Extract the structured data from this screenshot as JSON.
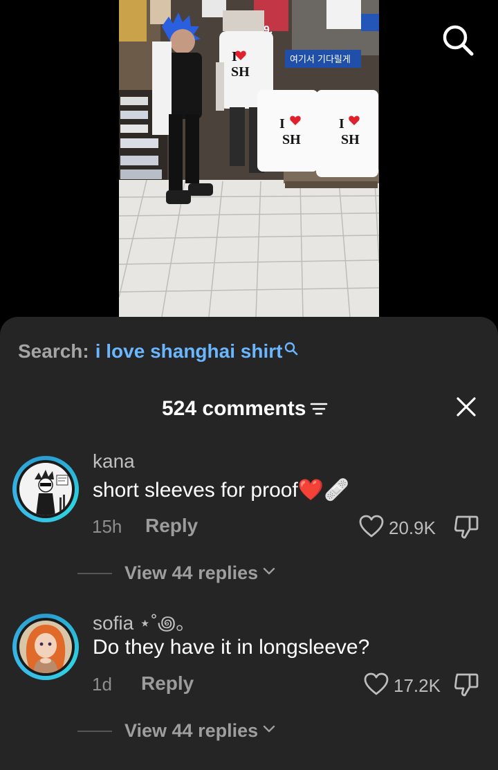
{
  "search": {
    "prefix": "Search:",
    "query": "i love shanghai shirt"
  },
  "video": {
    "shirt_text": [
      "I",
      "SH"
    ],
    "store_sign": "여기서 기다릴게",
    "price_tag": "39."
  },
  "header": {
    "count_label": "524 comments"
  },
  "comments": [
    {
      "username": "kana",
      "text": "short sleeves for proof❤️🩹",
      "time": "15h",
      "reply_label": "Reply",
      "likes": "20.9K",
      "view_replies": "View 44 replies"
    },
    {
      "username": "sofia ⋆˚꩜｡",
      "text": "Do they have it in longsleeve?",
      "time": "1d",
      "reply_label": "Reply",
      "likes": "17.2K",
      "view_replies": "View 44 replies"
    }
  ],
  "colors": {
    "sheet_bg": "#252525",
    "accent_blue": "#6ab6ff",
    "avatar_ring": "#2fd2e0",
    "heart_red": "#e0202a"
  },
  "icons": [
    "search-icon",
    "sort-icon",
    "close-icon",
    "heart-icon",
    "dislike-icon",
    "chevron-down-icon"
  ]
}
